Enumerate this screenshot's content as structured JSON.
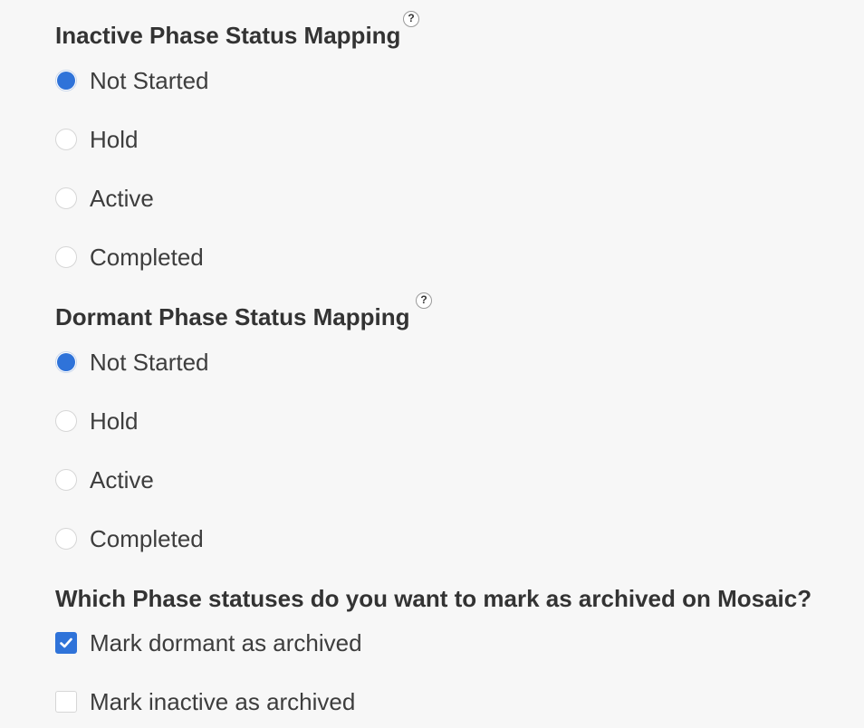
{
  "inactive_mapping": {
    "title": "Inactive Phase Status Mapping",
    "help_icon": "question-mark-icon",
    "options": [
      {
        "label": "Not Started",
        "checked": true
      },
      {
        "label": "Hold",
        "checked": false
      },
      {
        "label": "Active",
        "checked": false
      },
      {
        "label": "Completed",
        "checked": false
      }
    ]
  },
  "dormant_mapping": {
    "title": "Dormant Phase Status Mapping",
    "help_icon": "question-mark-icon",
    "options": [
      {
        "label": "Not Started",
        "checked": true
      },
      {
        "label": "Hold",
        "checked": false
      },
      {
        "label": "Active",
        "checked": false
      },
      {
        "label": "Completed",
        "checked": false
      }
    ]
  },
  "archive": {
    "question": "Which Phase statuses do you want to mark as archived on Mosaic?",
    "options": [
      {
        "label": "Mark dormant as archived",
        "checked": true
      },
      {
        "label": "Mark inactive as archived",
        "checked": false
      }
    ]
  },
  "colors": {
    "accent": "#2f73d9",
    "background": "#f7f7f7",
    "text": "#3a3a3a"
  },
  "help_glyph": "?"
}
